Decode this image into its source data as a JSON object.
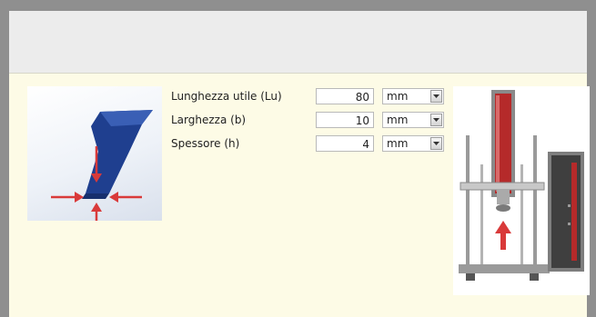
{
  "window": {
    "title": ""
  },
  "form": {
    "rows": [
      {
        "label": "Lunghezza utile (Lu)",
        "value": "80",
        "unit": "mm"
      },
      {
        "label": "Larghezza (b)",
        "value": "10",
        "unit": "mm"
      },
      {
        "label": "Spessore (h)",
        "value": "4",
        "unit": "mm"
      }
    ]
  },
  "icons": {
    "specimen": "specimen-diagram-icon",
    "machine": "test-machine-icon",
    "dropdown": "chevron-down-icon"
  },
  "colors": {
    "panel_background": "#fdfbe6",
    "specimen_blue": "#1f3f8f",
    "arrow_red": "#d93a3a",
    "column_red": "#b52a2a"
  }
}
